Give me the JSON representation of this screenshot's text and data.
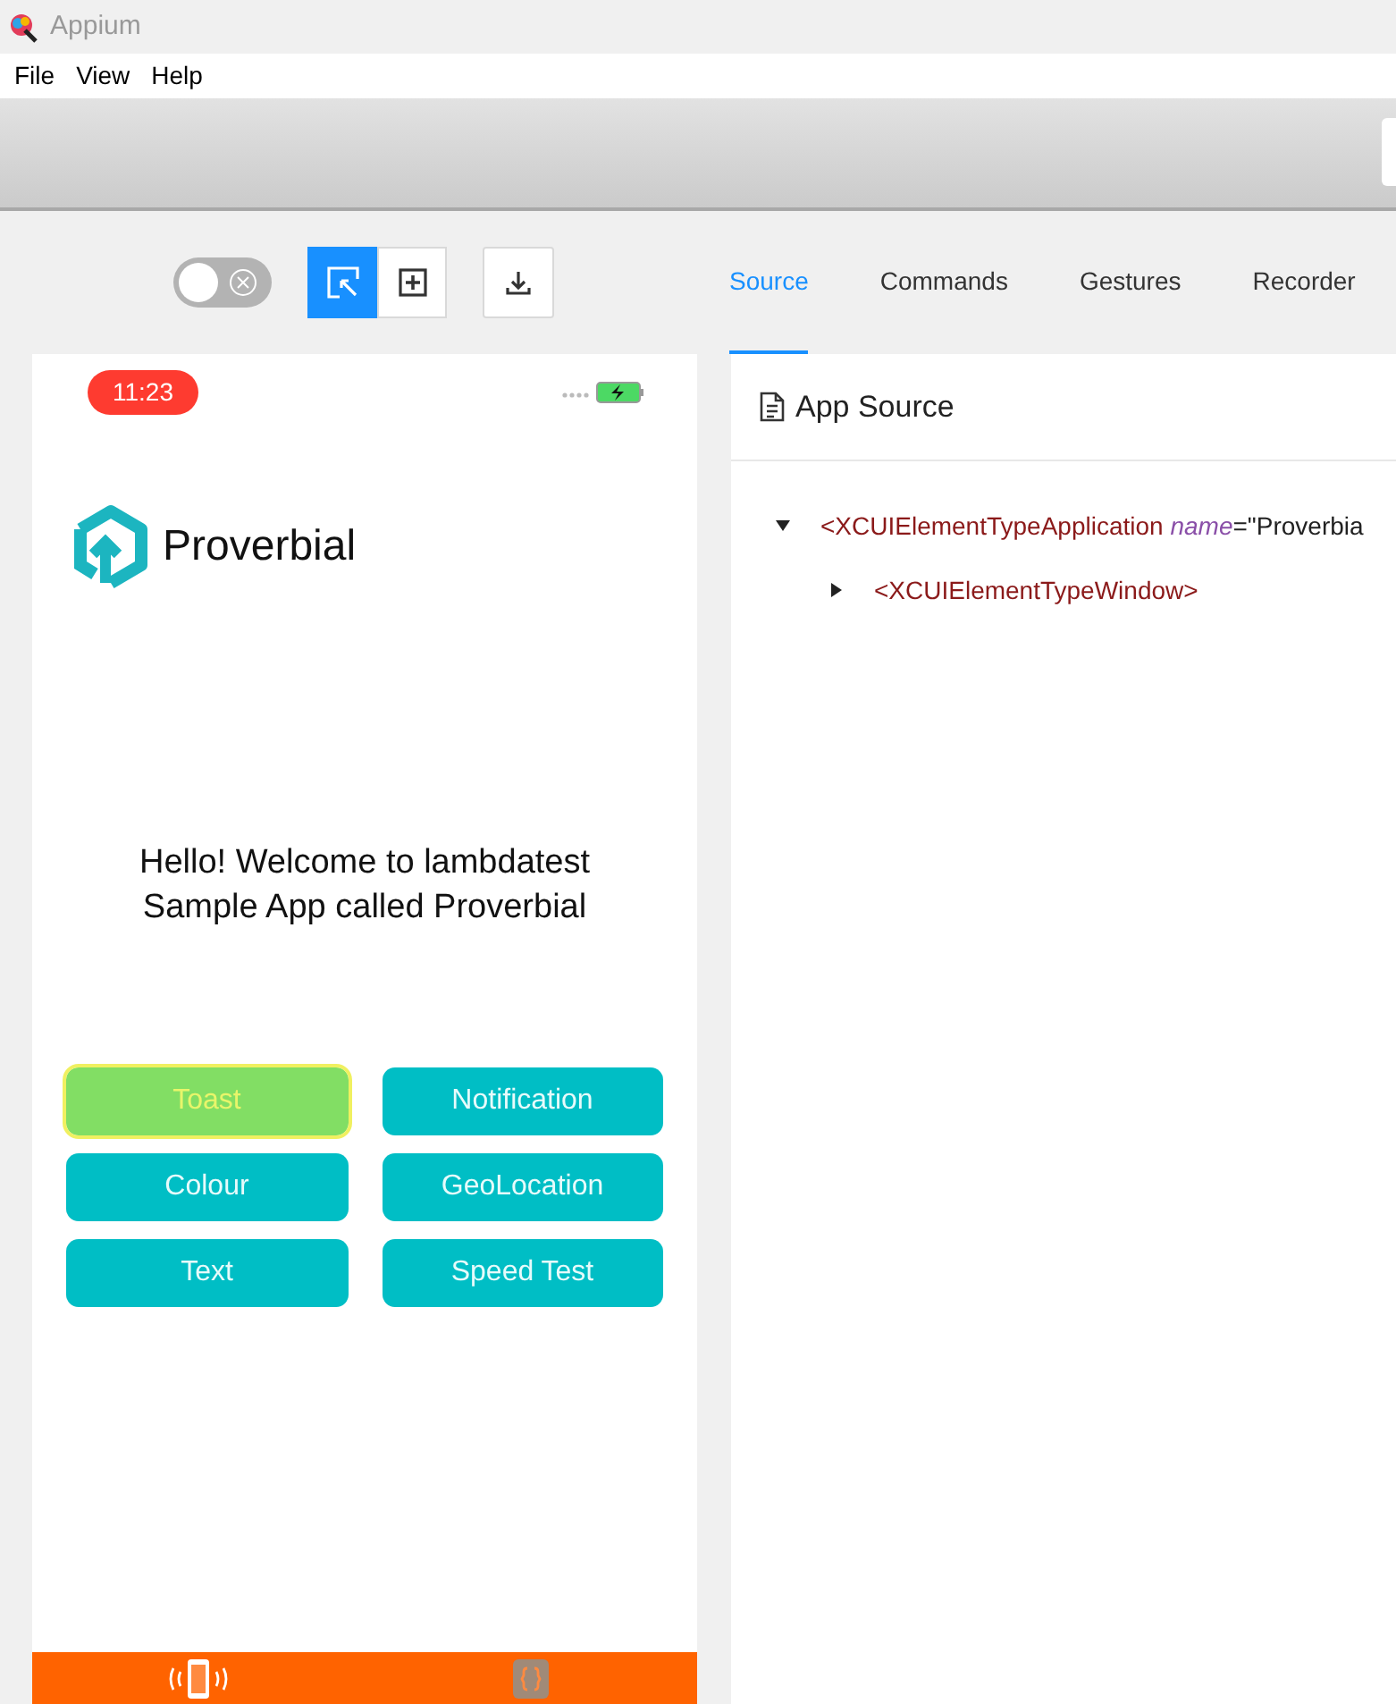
{
  "window": {
    "title": "Appium"
  },
  "menu": [
    "File",
    "View",
    "Help"
  ],
  "toolbar": {
    "screenshot_toggle": {
      "on": false
    },
    "modes": [
      {
        "kind": "select",
        "selected": true
      },
      {
        "kind": "tap",
        "selected": false
      }
    ]
  },
  "tabs": [
    {
      "label": "Source",
      "selected": true
    },
    {
      "label": "Commands",
      "selected": false
    },
    {
      "label": "Gestures",
      "selected": false
    },
    {
      "label": "Recorder",
      "selected": false
    }
  ],
  "device": {
    "time": "11:23",
    "app_name": "Proverbial",
    "welcome": "Hello! Welcome to lambdatest Sample App called Proverbial",
    "buttons": [
      {
        "label": "Toast",
        "highlighted": true
      },
      {
        "label": "Notification",
        "highlighted": false
      },
      {
        "label": "Colour",
        "highlighted": false
      },
      {
        "label": "GeoLocation",
        "highlighted": false
      },
      {
        "label": "Text",
        "highlighted": false
      },
      {
        "label": "Speed Test",
        "highlighted": false
      }
    ],
    "bottom_tabs": [
      {
        "kind": "phone",
        "selected": true
      },
      {
        "kind": "braces",
        "selected": false
      }
    ]
  },
  "source": {
    "title": "App Source",
    "tree": [
      {
        "tag": "<XCUIElementTypeApplication",
        "attribute": "name",
        "equals": "=",
        "value": "\"Proverbia",
        "expanded": true,
        "children": [
          {
            "tag": "<XCUIElementTypeWindow>",
            "expanded": false
          }
        ]
      }
    ]
  }
}
